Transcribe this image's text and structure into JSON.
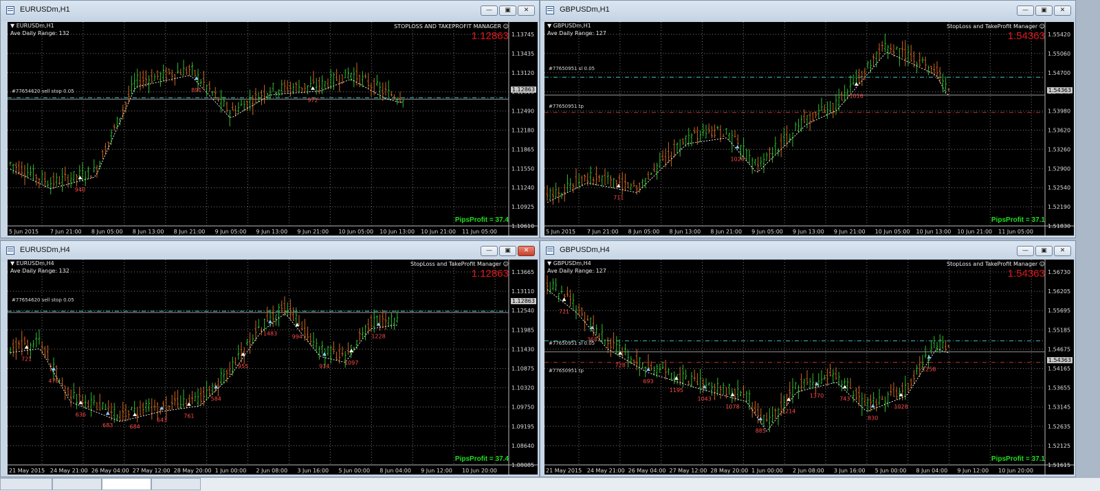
{
  "windows": [
    {
      "title": "EURUSDm,H1",
      "chart_label": "EURUSDm,H1",
      "adr": "Ave Daily Range: 132",
      "manager": "STOPLOSS AND TAKEPROFIT MANAGER ☺",
      "price": "1.12863",
      "price_tag": "1.12863",
      "pips": "PipsProfit = 37.4",
      "order_label": "#77654620 sell stop 0.05",
      "order_label2": "",
      "y_ticks": [
        "1.13745",
        "1.13435",
        "1.13120",
        "1.12805",
        "1.12490",
        "1.12180",
        "1.11865",
        "1.11550",
        "1.11240",
        "1.10925",
        "1.10610"
      ],
      "x_ticks": [
        "5 Jun 2015",
        "7 Jun 21:00",
        "8 Jun 05:00",
        "8 Jun 13:00",
        "8 Jun 21:00",
        "9 Jun 05:00",
        "9 Jun 13:00",
        "9 Jun 21:00",
        "10 Jun 05:00",
        "10 Jun 13:00",
        "10 Jun 21:00",
        "11 Jun 05:00"
      ],
      "counts": [
        "940",
        "891",
        "972"
      ]
    },
    {
      "title": "GBPUSDm,H1",
      "chart_label": "GBPUSDm,H1",
      "adr": "Ave Daily Range: 127",
      "manager": "StopLoss and TakeProfit Manager ☺",
      "price": "1.54363",
      "price_tag": "1.54363",
      "pips": "PipsProfit = 37.1",
      "order_label": "#77650951 sl 0.05",
      "order_label2": "#77650951 tp",
      "y_ticks": [
        "1.55420",
        "1.55060",
        "1.54700",
        "1.54340",
        "1.53980",
        "1.53620",
        "1.53260",
        "1.52900",
        "1.52540",
        "1.52190",
        "1.51830"
      ],
      "x_ticks": [
        "5 Jun 2015",
        "7 Jun 21:00",
        "8 Jun 05:00",
        "8 Jun 13:00",
        "8 Jun 21:00",
        "9 Jun 05:00",
        "9 Jun 13:00",
        "9 Jun 21:00",
        "10 Jun 05:00",
        "10 Jun 13:00",
        "10 Jun 21:00",
        "11 Jun 05:00"
      ],
      "counts": [
        "711",
        "1026",
        "1016"
      ]
    },
    {
      "title": "EURUSDm,H4",
      "chart_label": "EURUSDm,H4",
      "adr": "Ave Daily Range: 132",
      "manager": "StopLoss and TakeProfit Manager ☺",
      "price": "1.12863",
      "price_tag": "1.12863",
      "pips": "PipsProfit = 37.4",
      "order_label": "#77654620 sell stop 0.05",
      "order_label2": "",
      "y_ticks": [
        "1.13665",
        "1.13110",
        "1.12540",
        "1.11985",
        "1.11430",
        "1.10875",
        "1.10320",
        "1.09750",
        "1.09195",
        "1.08640",
        "1.08085"
      ],
      "x_ticks": [
        "21 May 2015",
        "24 May 21:00",
        "26 May 04:00",
        "27 May 12:00",
        "28 May 20:00",
        "1 Jun 00:00",
        "2 Jun 08:00",
        "3 Jun 16:00",
        "5 Jun 00:00",
        "8 Jun 04:00",
        "9 Jun 12:00",
        "10 Jun 20:00"
      ],
      "counts": [
        "721",
        "476",
        "636",
        "683",
        "684",
        "643",
        "761",
        "584",
        "955",
        "1483",
        "994",
        "914",
        "1097",
        "1228"
      ]
    },
    {
      "title": "GBPUSDm,H4",
      "chart_label": "GBPUSDm,H4",
      "adr": "Ave Daily Range: 127",
      "manager": "StopLoss and TakeProfit Manager ☺",
      "price": "1.54363",
      "price_tag": "1.54363",
      "pips": "PipsProfit = 37.1",
      "order_label": "#77650951 sl 0.05",
      "order_label2": "#77650951 tp",
      "y_ticks": [
        "1.56730",
        "1.56205",
        "1.55695",
        "1.55185",
        "1.54675",
        "1.54165",
        "1.53655",
        "1.53145",
        "1.52635",
        "1.52125",
        "1.51615"
      ],
      "x_ticks": [
        "21 May 2015",
        "24 May 21:00",
        "26 May 04:00",
        "27 May 12:00",
        "28 May 20:00",
        "1 Jun 00:00",
        "2 Jun 08:00",
        "3 Jun 16:00",
        "5 Jun 00:00",
        "8 Jun 04:00",
        "9 Jun 12:00",
        "10 Jun 20:00"
      ],
      "counts": [
        "721",
        "368",
        "728",
        "693",
        "1195",
        "1043",
        "1078",
        "885",
        "1214",
        "1370",
        "743",
        "830",
        "1028",
        "1258"
      ]
    }
  ],
  "colors": {
    "bull": "#2fc02f",
    "bear": "#d2691e",
    "neutral": "#e6e6e6",
    "order_line": "#40c8c8",
    "tp_line": "#c83232",
    "grid": "#7a7a7a",
    "price_red": "#e0171d",
    "pips_green": "#1fe01f"
  }
}
